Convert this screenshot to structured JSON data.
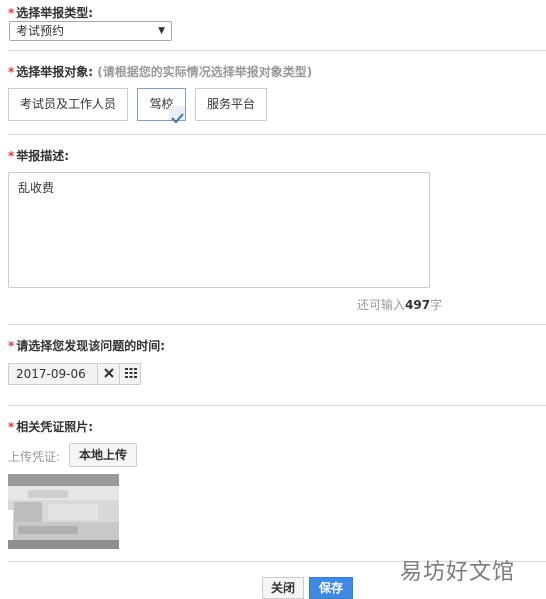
{
  "report_type": {
    "required_mark": "*",
    "label": "选择举报类型:",
    "selected": "考试预约"
  },
  "report_target": {
    "required_mark": "*",
    "label": "选择举报对象:",
    "hint": "(请根据您的实际情况选择举报对象类型)",
    "options": [
      {
        "label": "考试员及工作人员",
        "selected": false
      },
      {
        "label": "驾校",
        "selected": true
      },
      {
        "label": "服务平台",
        "selected": false
      }
    ]
  },
  "description": {
    "required_mark": "*",
    "label": "举报描述:",
    "value": "乱收费",
    "counter_prefix": "还可输入",
    "counter_value": "497",
    "counter_suffix": "字"
  },
  "time": {
    "required_mark": "*",
    "label": "请选择您发现该问题的时间:",
    "date": "2017-09-06"
  },
  "evidence": {
    "required_mark": "*",
    "label": "相关凭证照片:",
    "upload_label": "上传凭证:",
    "upload_button": "本地上传"
  },
  "footer": {
    "close_label": "关闭",
    "save_label": "保存"
  },
  "watermark": "易坊好文馆",
  "colors": {
    "accent": "#3f8ae0",
    "required": "#e4393c"
  }
}
